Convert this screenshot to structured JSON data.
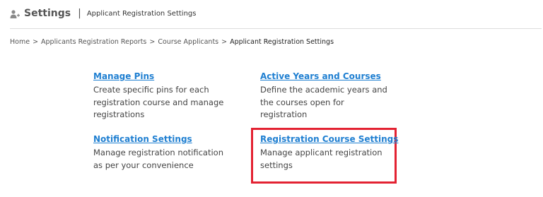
{
  "header": {
    "icon": "user-settings-icon",
    "title": "Settings",
    "separator": "|",
    "subtitle": "Applicant Registration Settings"
  },
  "breadcrumb": {
    "items": [
      "Home",
      "Applicants Registration Reports",
      "Course Applicants",
      "Applicant Registration Settings"
    ],
    "separator": ">"
  },
  "tiles": [
    {
      "title": "Manage Pins",
      "description": "Create specific pins for each registration course and manage registrations"
    },
    {
      "title": "Active Years and Courses",
      "description": "Define the academic years and the courses open for registration"
    },
    {
      "title": "Notification Settings",
      "description": "Manage registration notification as per your convenience"
    },
    {
      "title": "Registration Course Settings",
      "description": "Manage applicant registration settings"
    }
  ],
  "colors": {
    "link": "#1f7fd1",
    "highlight": "#e32232",
    "text": "#444444"
  }
}
